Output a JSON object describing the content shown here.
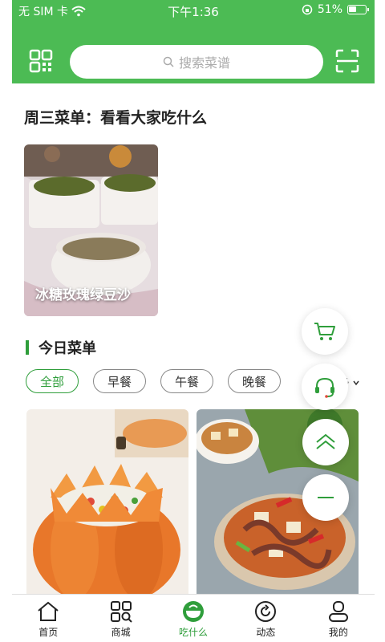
{
  "status_bar": {
    "carrier": "无 SIM 卡",
    "time": "下午1:36",
    "battery": "51%"
  },
  "search": {
    "placeholder": "搜索菜谱"
  },
  "weekday_section": {
    "title": "周三菜单：看看大家吃什么"
  },
  "feature_card": {
    "caption": "冰糖玫瑰绿豆沙"
  },
  "today_section": {
    "title": "今日菜单"
  },
  "filters": [
    {
      "label": "全部",
      "active": true
    },
    {
      "label": "早餐",
      "active": false
    },
    {
      "label": "午餐",
      "active": false
    },
    {
      "label": "晚餐",
      "active": false
    }
  ],
  "more_label": "更多",
  "colors": {
    "brand_green": "#4cbb54",
    "accent_green": "#2f9e3b"
  },
  "floating_buttons": [
    "cart-icon",
    "headset-icon",
    "back-to-top-icon",
    "minimize-icon"
  ],
  "tabbar": [
    {
      "label": "首页",
      "icon": "home-icon",
      "active": false
    },
    {
      "label": "商城",
      "icon": "mall-icon",
      "active": false
    },
    {
      "label": "吃什么",
      "icon": "bowl-icon",
      "active": true
    },
    {
      "label": "动态",
      "icon": "refresh-icon",
      "active": false
    },
    {
      "label": "我的",
      "icon": "profile-icon",
      "active": false
    }
  ]
}
